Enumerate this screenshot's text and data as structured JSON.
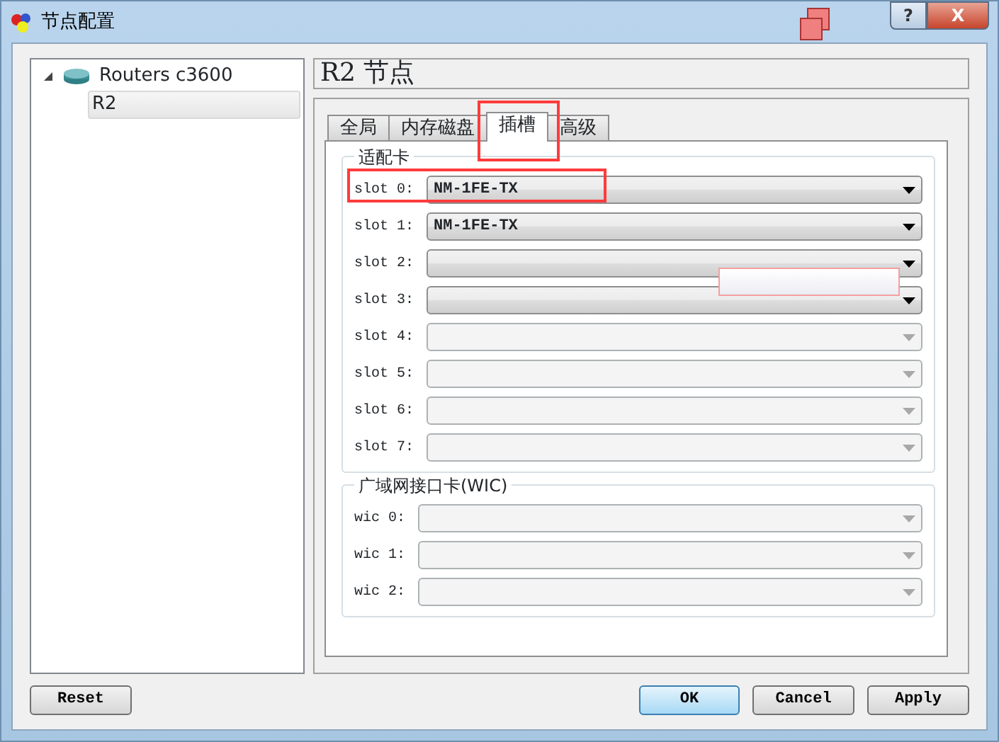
{
  "window": {
    "title": "节点配置",
    "buttons": [
      "?",
      "X"
    ]
  },
  "tree": [
    {
      "label": "Routers c3600",
      "expanded": true,
      "selected": false,
      "children": [
        {
          "label": "R2",
          "selected": true
        }
      ]
    }
  ],
  "header": "R2 节点",
  "tabs": [
    {
      "label": "全局",
      "selected": false,
      "highlighted": false
    },
    {
      "label": "内存磁盘",
      "selected": false,
      "highlighted": false
    },
    {
      "label": "插槽",
      "selected": true,
      "highlighted": true
    },
    {
      "label": "高级",
      "selected": false,
      "highlighted": false
    }
  ],
  "groups": [
    {
      "title": "适配卡",
      "rows": [
        {
          "label": "slot 0:",
          "value": "NM-1FE-TX",
          "disabled": false,
          "highlighted": true
        },
        {
          "label": "slot 1:",
          "value": "NM-1FE-TX",
          "disabled": false,
          "highlighted": false
        },
        {
          "label": "slot 2:",
          "disabled": false,
          "highlighted": false
        },
        {
          "label": "slot 3:",
          "disabled": false,
          "highlighted": false
        },
        {
          "label": "slot 4:",
          "disabled": true,
          "highlighted": false
        },
        {
          "label": "slot 5:",
          "disabled": true,
          "highlighted": false
        },
        {
          "label": "slot 6:",
          "disabled": true,
          "highlighted": false
        },
        {
          "label": "slot 7:",
          "disabled": true,
          "highlighted": false
        }
      ]
    },
    {
      "title": "广域网接口卡(WIC)",
      "rows": [
        {
          "label": "wic 0:",
          "disabled": true,
          "highlighted": false
        },
        {
          "label": "wic 1:",
          "disabled": true,
          "highlighted": false
        },
        {
          "label": "wic 2:",
          "disabled": true,
          "highlighted": false
        }
      ]
    }
  ],
  "buttons": [
    {
      "label": "Reset",
      "default": false
    },
    {
      "label": "OK",
      "default": true
    },
    {
      "label": "Cancel",
      "default": false
    },
    {
      "label": "Apply",
      "default": false
    }
  ]
}
